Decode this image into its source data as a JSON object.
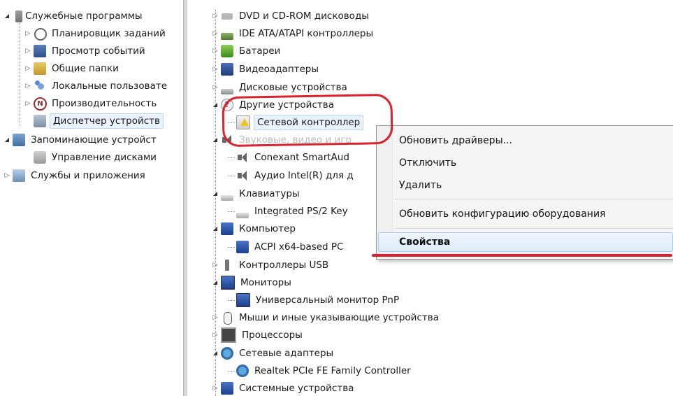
{
  "left_tree": [
    {
      "label": "Служебные программы",
      "icon": "tools-icon"
    },
    {
      "label": "Планировщик заданий",
      "icon": "clock-icon"
    },
    {
      "label": "Просмотр событий",
      "icon": "event-log-icon"
    },
    {
      "label": "Общие папки",
      "icon": "shared-folder-icon"
    },
    {
      "label": "Локальные пользовате",
      "icon": "users-icon"
    },
    {
      "label": "Производительность",
      "icon": "performance-icon"
    },
    {
      "label": "Диспетчер устройств",
      "icon": "device-manager-icon"
    },
    {
      "label": "Запоминающие устройст",
      "icon": "storage-icon"
    },
    {
      "label": "Управление дисками",
      "icon": "disk-management-icon"
    },
    {
      "label": "Службы и приложения",
      "icon": "services-icon"
    }
  ],
  "right_tree": [
    {
      "label": "DVD и CD-ROM дисководы",
      "icon": "dvd-drive-icon"
    },
    {
      "label": "IDE ATA/ATAPI контроллеры",
      "icon": "ide-controller-icon"
    },
    {
      "label": "Батареи",
      "icon": "battery-icon"
    },
    {
      "label": "Видеоадаптеры",
      "icon": "display-adapter-icon"
    },
    {
      "label": "Дисковые устройства",
      "icon": "hard-disk-icon"
    },
    {
      "label": "Другие устройства",
      "icon": "other-devices-icon"
    },
    {
      "label": "Сетевой контроллер",
      "icon": "warning-device-icon"
    },
    {
      "label": "Звуковые, видео и игр",
      "icon": "sound-icon"
    },
    {
      "label": "Conexant SmartAud",
      "icon": "speaker-icon"
    },
    {
      "label": "Аудио Intel(R) для д",
      "icon": "speaker-icon"
    },
    {
      "label": "Клавиатуры",
      "icon": "keyboard-icon"
    },
    {
      "label": "Integrated PS/2 Key",
      "icon": "keyboard-icon"
    },
    {
      "label": "Компьютер",
      "icon": "computer-icon"
    },
    {
      "label": "ACPI x64-based PC",
      "icon": "computer-icon"
    },
    {
      "label": "Контроллеры USB",
      "icon": "usb-icon"
    },
    {
      "label": "Мониторы",
      "icon": "monitor-icon"
    },
    {
      "label": "Универсальный монитор PnP",
      "icon": "monitor-icon"
    },
    {
      "label": "Мыши и иные указывающие устройства",
      "icon": "mouse-icon"
    },
    {
      "label": "Процессоры",
      "icon": "processor-icon"
    },
    {
      "label": "Сетевые адаптеры",
      "icon": "network-adapter-icon"
    },
    {
      "label": "Realtek PCIe FE Family Controller",
      "icon": "network-adapter-icon"
    },
    {
      "label": "Системные устройства",
      "icon": "system-devices-icon"
    }
  ],
  "context_menu": {
    "update_drivers": "Обновить драйверы...",
    "disable": "Отключить",
    "uninstall": "Удалить",
    "scan_hardware": "Обновить конфигурацию оборудования",
    "properties": "Свойства"
  },
  "colors": {
    "annotation": "#d9232e",
    "selection": "#eaf3fc",
    "menu_highlight": "#dcebfa"
  }
}
